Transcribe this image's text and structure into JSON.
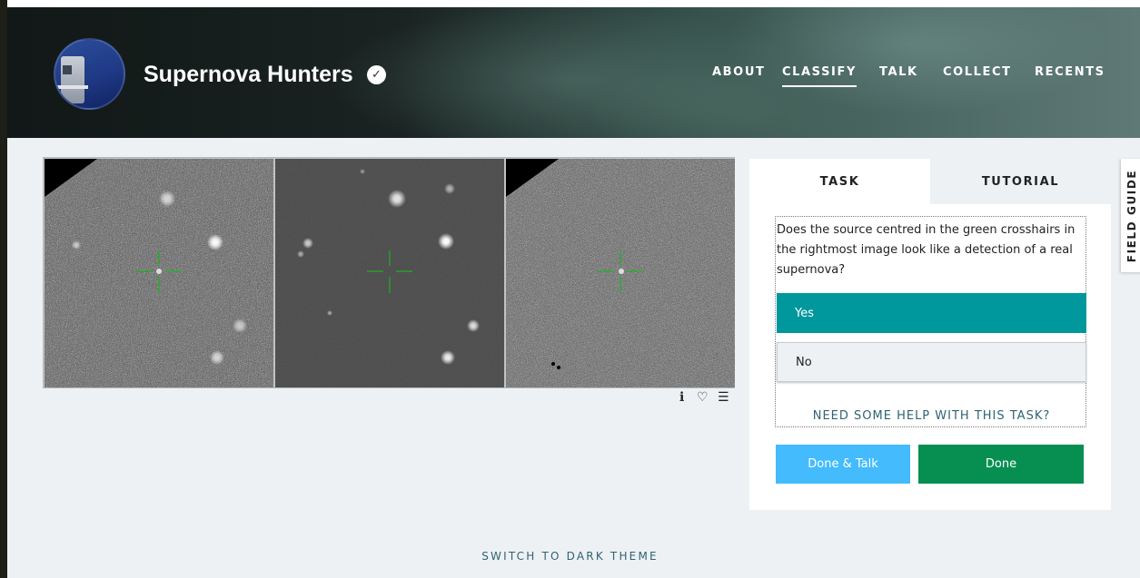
{
  "header": {
    "project_title": "Supernova Hunters",
    "nav": [
      {
        "label": "ABOUT",
        "active": false
      },
      {
        "label": "CLASSIFY",
        "active": true
      },
      {
        "label": "TALK",
        "active": false
      },
      {
        "label": "COLLECT",
        "active": false
      },
      {
        "label": "RECENTS",
        "active": false
      }
    ]
  },
  "viewer": {
    "panels": [
      "new-image",
      "reference-image",
      "difference-image"
    ],
    "icons": [
      "info-icon",
      "heart-icon",
      "list-icon"
    ]
  },
  "task": {
    "tabs": {
      "task": "TASK",
      "tutorial": "TUTORIAL"
    },
    "question": "Does the source centred in the green crosshairs in the rightmost image look like a detection of a real supernova?",
    "answers": [
      {
        "label": "Yes",
        "selected": true
      },
      {
        "label": "No",
        "selected": false
      }
    ],
    "help_link": "NEED SOME HELP WITH THIS TASK?",
    "buttons": {
      "done_talk": "Done & Talk",
      "done": "Done"
    }
  },
  "field_guide": "FIELD GUIDE",
  "footer": {
    "theme_toggle": "SWITCH TO DARK THEME"
  },
  "colors": {
    "teal_selected": "#00979d",
    "done_talk_blue": "#43bbfd",
    "done_green": "#078f52",
    "link_teal": "#2f6372",
    "crosshair_green": "#1db31d"
  }
}
